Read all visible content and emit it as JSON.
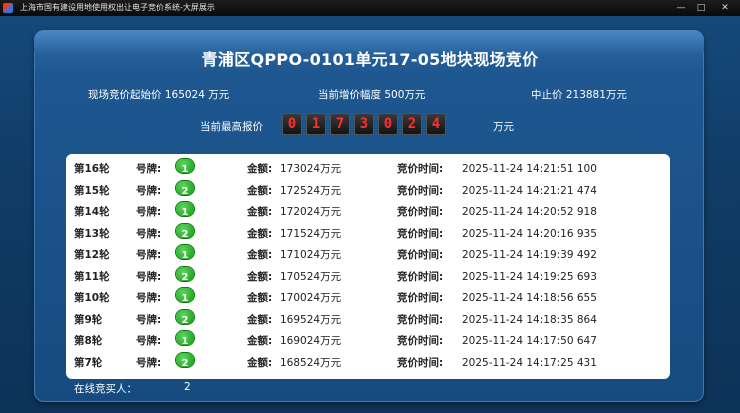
{
  "window": {
    "title": "上海市国有建设用地使用权出让电子竞价系统-大屏展示",
    "min": "—",
    "max": "□",
    "close": "✕"
  },
  "auction": {
    "title": "青浦区QPPO-0101单元17-05地块现场竞价",
    "start_price": "现场竞价起始价 165024 万元",
    "increment": "当前增价幅度 500万元",
    "cap_price": "中止价 213881万元",
    "current_label": "当前最高报价",
    "current_digits": [
      "0",
      "1",
      "7",
      "3",
      "0",
      "2",
      "4"
    ],
    "current_unit": "万元"
  },
  "table": {
    "labels": {
      "number": "号牌:",
      "amount": "金额:",
      "time": "竞价时间:"
    },
    "rows": [
      {
        "round": "第16轮",
        "number": "1",
        "amount": "173024万元",
        "time": "2025-11-24 14:21:51 100"
      },
      {
        "round": "第15轮",
        "number": "2",
        "amount": "172524万元",
        "time": "2025-11-24 14:21:21 474"
      },
      {
        "round": "第14轮",
        "number": "1",
        "amount": "172024万元",
        "time": "2025-11-24 14:20:52 918"
      },
      {
        "round": "第13轮",
        "number": "2",
        "amount": "171524万元",
        "time": "2025-11-24 14:20:16 935"
      },
      {
        "round": "第12轮",
        "number": "1",
        "amount": "171024万元",
        "time": "2025-11-24 14:19:39 492"
      },
      {
        "round": "第11轮",
        "number": "2",
        "amount": "170524万元",
        "time": "2025-11-24 14:19:25 693"
      },
      {
        "round": "第10轮",
        "number": "1",
        "amount": "170024万元",
        "time": "2025-11-24 14:18:56 655"
      },
      {
        "round": "第9轮",
        "number": "2",
        "amount": "169524万元",
        "time": "2025-11-24 14:18:35 864"
      },
      {
        "round": "第8轮",
        "number": "1",
        "amount": "169024万元",
        "time": "2025-11-24 14:17:50 647"
      },
      {
        "round": "第7轮",
        "number": "2",
        "amount": "168524万元",
        "time": "2025-11-24 14:17:25 431"
      }
    ]
  },
  "footer": {
    "online_label": "在线竞买人：",
    "online_count": "2"
  }
}
